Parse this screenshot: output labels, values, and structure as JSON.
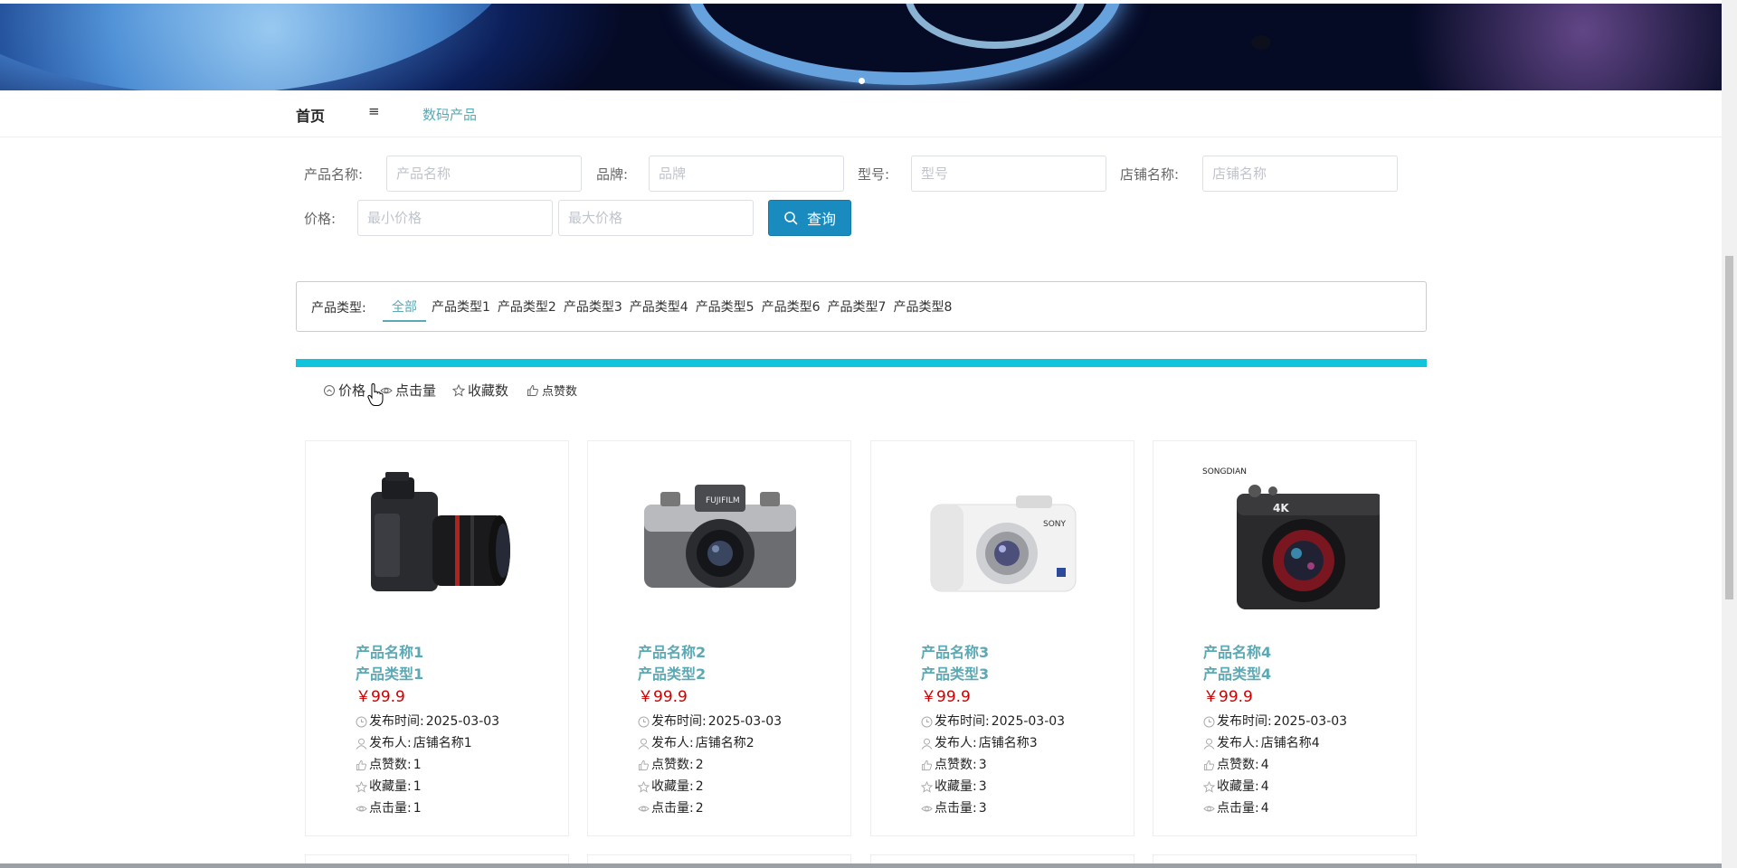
{
  "nav": {
    "home_label": "首页",
    "menu_icon": "≡",
    "current_label": "数码产品"
  },
  "search": {
    "name_label": "产品名称:",
    "name_placeholder": "产品名称",
    "brand_label": "品牌:",
    "brand_placeholder": "品牌",
    "model_label": "型号:",
    "model_placeholder": "型号",
    "shop_label": "店铺名称:",
    "shop_placeholder": "店铺名称",
    "price_label": "价格:",
    "min_price_placeholder": "最小价格",
    "max_price_placeholder": "最大价格",
    "button_label": "查询"
  },
  "category": {
    "label": "产品类型:",
    "items": [
      "全部",
      "产品类型1",
      "产品类型2",
      "产品类型3",
      "产品类型4",
      "产品类型5",
      "产品类型6",
      "产品类型7",
      "产品类型8"
    ],
    "active_index": 0
  },
  "sort": {
    "items": [
      {
        "label": "价格",
        "icon": "clock-icon"
      },
      {
        "label": "点击量",
        "icon": "eye-icon"
      },
      {
        "label": "收藏数",
        "icon": "star-icon"
      },
      {
        "label": "点赞数",
        "icon": "thumb-up-icon"
      }
    ]
  },
  "products": [
    {
      "name": "产品名称1",
      "type": "产品类型1",
      "price": "￥99.9",
      "publish_time_label": "发布时间:",
      "publish_time": "2025-03-03",
      "publisher_label": "发布人:",
      "publisher": "店铺名称1",
      "likes_label": "点赞数:",
      "likes": "1",
      "favorites_label": "收藏量:",
      "favorites": "1",
      "clicks_label": "点击量:",
      "clicks": "1"
    },
    {
      "name": "产品名称2",
      "type": "产品类型2",
      "price": "￥99.9",
      "publish_time_label": "发布时间:",
      "publish_time": "2025-03-03",
      "publisher_label": "发布人:",
      "publisher": "店铺名称2",
      "likes_label": "点赞数:",
      "likes": "2",
      "favorites_label": "收藏量:",
      "favorites": "2",
      "clicks_label": "点击量:",
      "clicks": "2"
    },
    {
      "name": "产品名称3",
      "type": "产品类型3",
      "price": "￥99.9",
      "publish_time_label": "发布时间:",
      "publish_time": "2025-03-03",
      "publisher_label": "发布人:",
      "publisher": "店铺名称3",
      "likes_label": "点赞数:",
      "likes": "3",
      "favorites_label": "收藏量:",
      "favorites": "3",
      "clicks_label": "点击量:",
      "clicks": "3"
    },
    {
      "name": "产品名称4",
      "type": "产品类型4",
      "price": "￥99.9",
      "publish_time_label": "发布时间:",
      "publish_time": "2025-03-03",
      "publisher_label": "发布人:",
      "publisher": "店铺名称4",
      "likes_label": "点赞数:",
      "likes": "4",
      "favorites_label": "收藏量:",
      "favorites": "4",
      "clicks_label": "点击量:",
      "clicks": "4"
    }
  ],
  "product_image_brand_text": {
    "card2": "FUJIFILM",
    "card3": "SONY",
    "card4_logo": "SONGDIAN",
    "card4_badge": "4K"
  },
  "colors": {
    "accent": "#5aa9b5",
    "button": "#1a8bbf",
    "bar": "#12c3dc",
    "price": "#cc0000"
  }
}
